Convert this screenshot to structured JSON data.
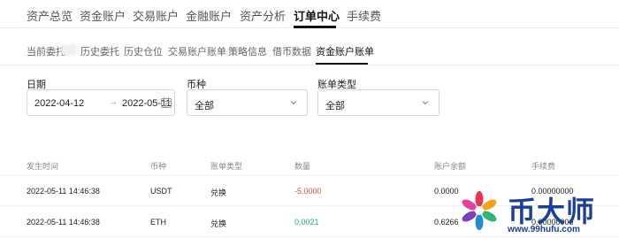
{
  "top_nav": {
    "items": [
      "资产总览",
      "资金账户",
      "交易账户",
      "金融账户",
      "资产分析",
      "订单中心",
      "手续费"
    ],
    "active": "订单中心"
  },
  "sub_nav": {
    "items": [
      "当前委托",
      "历史委托",
      "历史仓位",
      "交易账户账单",
      "策略信息",
      "借币数据",
      "资金账户账单"
    ],
    "active": "资金账户账单"
  },
  "filters": {
    "date": {
      "label": "日期",
      "start": "2022-04-12",
      "arrow": "→",
      "end": "2022-05-11",
      "icon": "calendar-icon"
    },
    "currency": {
      "label": "币种",
      "value": "全部",
      "icon": "chevron-down-icon"
    },
    "bill_type": {
      "label": "账单类型",
      "value": "全部",
      "icon": "chevron-down-icon"
    }
  },
  "table": {
    "headers": [
      "发生时间",
      "币种",
      "账单类型",
      "数量",
      "账户余额",
      "手续费"
    ],
    "rows": [
      {
        "time": "2022-05-11 14:46:38",
        "currency": "USDT",
        "type": "兑换",
        "amount": "-5.0000",
        "balance": "0.0000",
        "fee": "0.00000000"
      },
      {
        "time": "2022-05-11 14:46:38",
        "currency": "ETH",
        "type": "兑换",
        "amount": "0.0021",
        "balance": "0.6266",
        "fee": "0.00000000"
      }
    ]
  },
  "watermark": {
    "brand": "币大师",
    "url": "www.99hufu.com"
  },
  "colors": {
    "negative": "#e04a5a",
    "positive": "#1fae6b",
    "brand": "#1c3f9a"
  }
}
